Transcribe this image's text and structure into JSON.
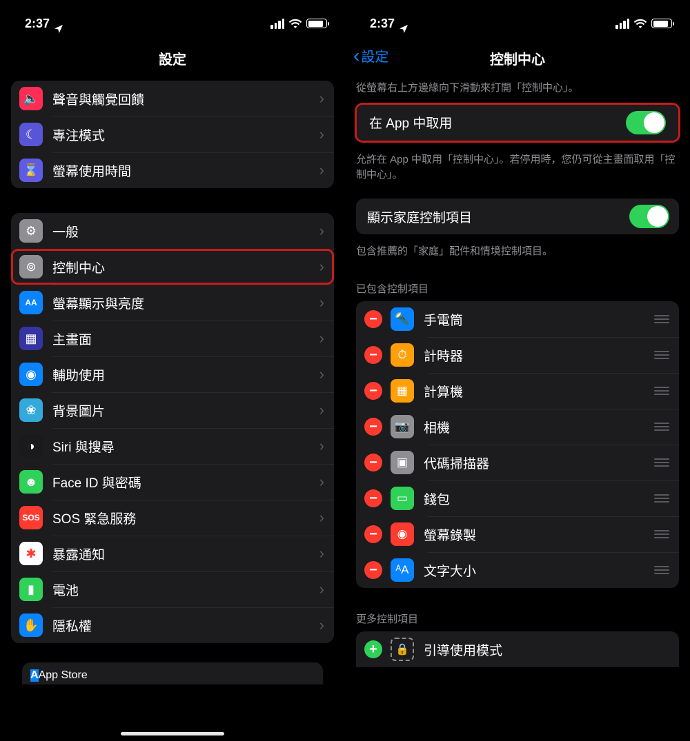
{
  "status": {
    "time": "2:37"
  },
  "left": {
    "title": "設定",
    "group1": [
      {
        "name": "sounds",
        "label": "聲音與觸覺回饋",
        "bg": "#ff2d55",
        "glyph": "🔈"
      },
      {
        "name": "focus",
        "label": "專注模式",
        "bg": "#5856d6",
        "glyph": "☾"
      },
      {
        "name": "screentime",
        "label": "螢幕使用時間",
        "bg": "#5e5ce6",
        "glyph": "⌛"
      }
    ],
    "group2": [
      {
        "name": "general",
        "label": "一般",
        "bg": "#8e8e93",
        "glyph": "⚙"
      },
      {
        "name": "control-center",
        "label": "控制中心",
        "bg": "#8e8e93",
        "glyph": "⊚",
        "hl": true
      },
      {
        "name": "display",
        "label": "螢幕顯示與亮度",
        "bg": "#0a84ff",
        "glyph": "AA"
      },
      {
        "name": "home-screen",
        "label": "主畫面",
        "bg": "#3634a3",
        "glyph": "▦"
      },
      {
        "name": "accessibility",
        "label": "輔助使用",
        "bg": "#0a84ff",
        "glyph": "◉"
      },
      {
        "name": "wallpaper",
        "label": "背景圖片",
        "bg": "#34aadc",
        "glyph": "❀"
      },
      {
        "name": "siri",
        "label": "Siri 與搜尋",
        "bg": "#1a1a1a",
        "glyph": "◑"
      },
      {
        "name": "faceid",
        "label": "Face ID 與密碼",
        "bg": "#2fd158",
        "glyph": "☻"
      },
      {
        "name": "sos",
        "label": "SOS 緊急服務",
        "bg": "#ff3b30",
        "glyph": "SOS"
      },
      {
        "name": "exposure",
        "label": "暴露通知",
        "bg": "#ffffff",
        "glyph": "✱",
        "fg": "#ff3b30"
      },
      {
        "name": "battery",
        "label": "電池",
        "bg": "#30d158",
        "glyph": "▮"
      },
      {
        "name": "privacy",
        "label": "隱私權",
        "bg": "#0a84ff",
        "glyph": "✋"
      }
    ],
    "app_store": {
      "label": "App Store",
      "bg": "#0a84ff",
      "glyph": "A"
    }
  },
  "right": {
    "back": "設定",
    "title": "控制中心",
    "hint_top": "從螢幕右上方邊緣向下滑動來打開「控制中心」。",
    "access_in_apps": "在 App 中取用",
    "access_desc": "允許在 App 中取用「控制中心」。若停用時，您仍可從主畫面取用「控制中心」。",
    "home_controls": "顯示家庭控制項目",
    "home_desc": "包含推薦的「家庭」配件和情境控制項目。",
    "included_header": "已包含控制項目",
    "included": [
      {
        "name": "flashlight",
        "label": "手電筒",
        "bg": "#0a84ff",
        "glyph": "🔦"
      },
      {
        "name": "timer",
        "label": "計時器",
        "bg": "#ff9f0a",
        "glyph": "⏱"
      },
      {
        "name": "calculator",
        "label": "計算機",
        "bg": "#ff9f0a",
        "glyph": "▦"
      },
      {
        "name": "camera",
        "label": "相機",
        "bg": "#8e8e93",
        "glyph": "📷"
      },
      {
        "name": "qr",
        "label": "代碼掃描器",
        "bg": "#8e8e93",
        "glyph": "▣"
      },
      {
        "name": "wallet",
        "label": "錢包",
        "bg": "#30d158",
        "glyph": "▭"
      },
      {
        "name": "screenrec",
        "label": "螢幕錄製",
        "bg": "#ff3b30",
        "glyph": "◉"
      },
      {
        "name": "textsize",
        "label": "文字大小",
        "bg": "#0a84ff",
        "glyph": "ᴬA"
      }
    ],
    "more_header": "更多控制項目",
    "more": [
      {
        "name": "guided",
        "label": "引導使用模式",
        "glyph": "🔒"
      }
    ]
  }
}
